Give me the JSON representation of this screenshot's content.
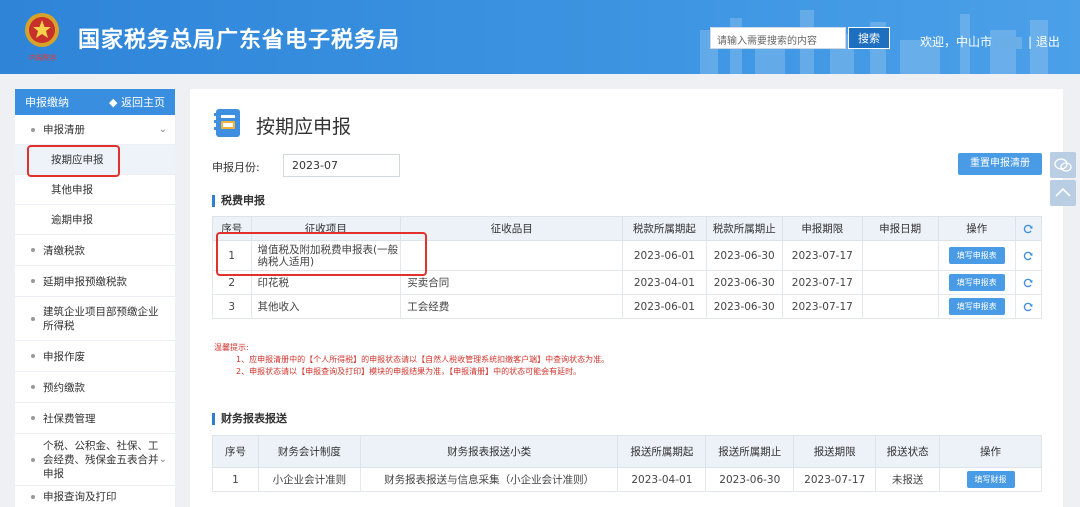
{
  "header": {
    "title": "国家税务总局广东省电子税务局",
    "emblem_text": "中国税务",
    "search_placeholder": "请输入需要搜索的内容",
    "search_button": "搜索",
    "welcome": "欢迎，中山市",
    "logout": "| 退出"
  },
  "sidebar": {
    "head_title": "申报缴纳",
    "back_label": "返回主页",
    "items": [
      {
        "label": "申报清册"
      },
      {
        "label": "按期应申报"
      },
      {
        "label": "其他申报"
      },
      {
        "label": "逾期申报"
      },
      {
        "label": "清缴税款"
      },
      {
        "label": "延期申报预缴税款"
      },
      {
        "label": "建筑企业项目部预缴企业所得税"
      },
      {
        "label": "申报作废"
      },
      {
        "label": "预约缴款"
      },
      {
        "label": "社保费管理"
      },
      {
        "label": "个税、公积金、社保、工会经费、残保金五表合并申报"
      },
      {
        "label": "申报查询及打印"
      }
    ]
  },
  "main": {
    "page_title": "按期应申报",
    "month_label": "申报月份:",
    "month_value": "2023-07",
    "reset_button": "重置申报清册",
    "tax_section": "税费申报",
    "tax_table": {
      "headers": [
        "序号",
        "征收项目",
        "征收品目",
        "税款所属期起",
        "税款所属期止",
        "申报期限",
        "申报日期",
        "操作"
      ],
      "rows": [
        {
          "no": "1",
          "item": "增值税及附加税费申报表(一般纳税人适用)",
          "sub": "",
          "start": "2023-06-01",
          "end": "2023-06-30",
          "deadline": "2023-07-17",
          "date": "",
          "action": "填写申报表"
        },
        {
          "no": "2",
          "item": "印花税",
          "sub": "买卖合同",
          "start": "2023-04-01",
          "end": "2023-06-30",
          "deadline": "2023-07-17",
          "date": "",
          "action": "填写申报表"
        },
        {
          "no": "3",
          "item": "其他收入",
          "sub": "工会经费",
          "start": "2023-06-01",
          "end": "2023-06-30",
          "deadline": "2023-07-17",
          "date": "",
          "action": "填写申报表"
        }
      ]
    },
    "notice": {
      "title": "温馨提示:",
      "line1": "1、应申报清册中的【个人所得税】的申报状态请以【自然人税收管理系统扣缴客户端】中查询状态为准。",
      "line2": "2、申报状态请以【申报查询及打印】模块的申报结果为准，【申报清册】中的状态可能会有延时。"
    },
    "finance_section": "财务报表报送",
    "finance_table": {
      "headers": [
        "序号",
        "财务会计制度",
        "财务报表报送小类",
        "报送所属期起",
        "报送所属期止",
        "报送期限",
        "报送状态",
        "操作"
      ],
      "rows": [
        {
          "no": "1",
          "system": "小企业会计准则",
          "sub": "财务报表报送与信息采集（小企业会计准则）",
          "start": "2023-04-01",
          "end": "2023-06-30",
          "deadline": "2023-07-17",
          "status": "未报送",
          "action": "填写财报"
        }
      ]
    }
  },
  "colors": {
    "header_blue": "#3a8ee0",
    "button_blue": "#4a9be5",
    "highlight_red": "#e0312c",
    "notice_red": "#d0342c"
  }
}
